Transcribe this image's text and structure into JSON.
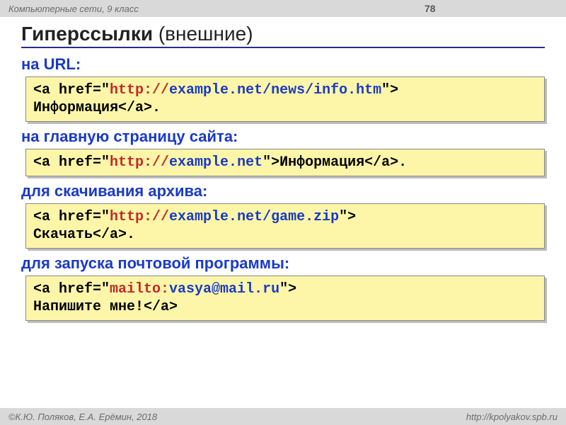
{
  "header": {
    "course": "Компьютерные сети, 9 класс",
    "page_number": "78"
  },
  "title": {
    "bold": "Гиперссылки",
    "rest": " (внешние)"
  },
  "sections": [
    {
      "label": "на URL:",
      "code": [
        {
          "t": "<a href=\"",
          "c": "c-black"
        },
        {
          "t": "http://",
          "c": "c-red"
        },
        {
          "t": "example.net/news/info.htm",
          "c": "c-blue"
        },
        {
          "t": "\">\nИнформация</a>.",
          "c": "c-black"
        }
      ]
    },
    {
      "label": "на главную страницу сайта:",
      "code": [
        {
          "t": "<a href=\"",
          "c": "c-black"
        },
        {
          "t": "http://",
          "c": "c-red"
        },
        {
          "t": "example.net",
          "c": "c-blue"
        },
        {
          "t": "\">Информация</a>.",
          "c": "c-black"
        }
      ]
    },
    {
      "label": "для скачивания архива:",
      "code": [
        {
          "t": "<a href=\"",
          "c": "c-black"
        },
        {
          "t": "http://",
          "c": "c-red"
        },
        {
          "t": "example.net/game.zip",
          "c": "c-blue"
        },
        {
          "t": "\">\nСкачать</a>.",
          "c": "c-black"
        }
      ]
    },
    {
      "label": "для запуска почтовой программы:",
      "code": [
        {
          "t": "<a href=\"",
          "c": "c-black"
        },
        {
          "t": "mailto:",
          "c": "c-red"
        },
        {
          "t": "vasya@mail.ru",
          "c": "c-blue"
        },
        {
          "t": "\">\nНапишите мне!</a>",
          "c": "c-black"
        }
      ]
    }
  ],
  "footer": {
    "left": "©К.Ю. Поляков, Е.А. Ерёмин, 2018",
    "right": "http://kpolyakov.spb.ru"
  }
}
